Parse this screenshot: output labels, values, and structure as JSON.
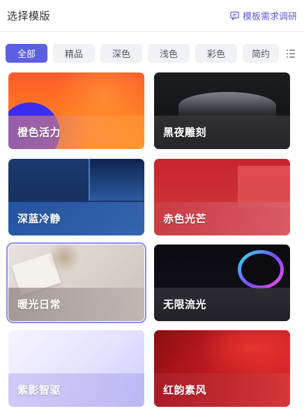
{
  "header": {
    "title": "选择模版",
    "survey_label": "模板需求调研",
    "survey_icon": "message-icon"
  },
  "tabs": [
    {
      "label": "全部",
      "active": true
    },
    {
      "label": "精品",
      "active": false
    },
    {
      "label": "深色",
      "active": false
    },
    {
      "label": "浅色",
      "active": false
    },
    {
      "label": "彩色",
      "active": false
    },
    {
      "label": "简约",
      "active": false
    }
  ],
  "more_icon": "list-icon",
  "templates": [
    {
      "name": "橙色活力",
      "theme": "orange"
    },
    {
      "name": "黑夜雕刻",
      "theme": "black"
    },
    {
      "name": "深蓝冷静",
      "theme": "navy"
    },
    {
      "name": "赤色光芒",
      "theme": "red"
    },
    {
      "name": "暖光日常",
      "theme": "beige",
      "selected": true
    },
    {
      "name": "无限流光",
      "theme": "dark-iridescent"
    },
    {
      "name": "紫影智驱",
      "theme": "lavender"
    },
    {
      "name": "红韵素风",
      "theme": "crimson"
    }
  ],
  "colors": {
    "accent": "#5b5fe0",
    "tab_bg": "#f1f2f8"
  }
}
